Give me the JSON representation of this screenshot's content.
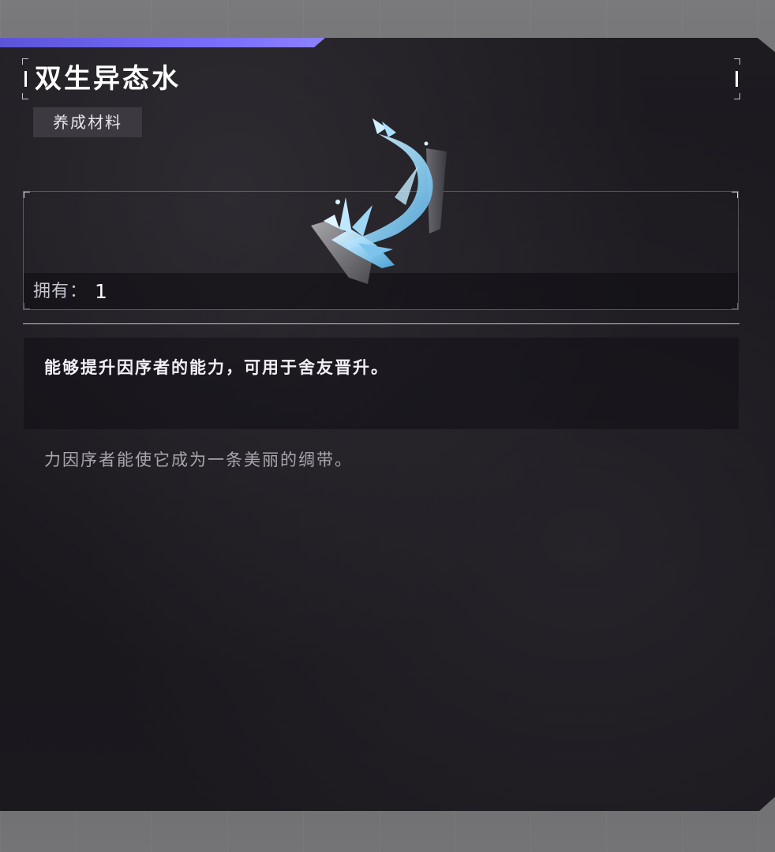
{
  "item": {
    "name": "双生异态水",
    "category": "养成材料",
    "owned_label": "拥有：",
    "owned_count": "1",
    "icon": "water-splash-icon"
  },
  "description": "能够提升因序者的能力，可用于舍友晋升。",
  "flavor_text": "力因序者能使它成为一条美丽的绸带。",
  "colors": {
    "accent": "#7b70ff",
    "panel": "#1c1a1f",
    "water": "#9ad8f8"
  }
}
